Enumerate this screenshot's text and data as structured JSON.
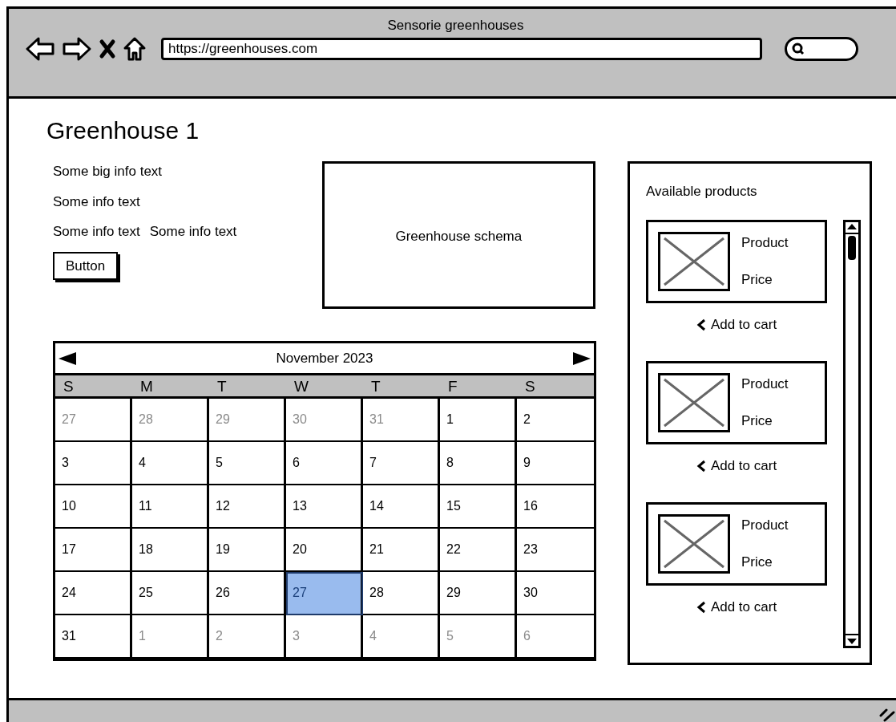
{
  "window": {
    "title": "Sensorie greenhouses"
  },
  "toolbar": {
    "url": "https://greenhouses.com"
  },
  "page": {
    "heading": "Greenhouse 1",
    "info_lines": [
      [
        "Some big info text"
      ],
      [
        "Some info text"
      ],
      [
        "Some info text",
        "Some info text"
      ]
    ],
    "button": "Button",
    "schema": {
      "label": "Greenhouse schema"
    }
  },
  "calendar": {
    "month": "November 2023",
    "weekdays": [
      "S",
      "M",
      "T",
      "W",
      "T",
      "F",
      "S"
    ],
    "weeks": [
      [
        {
          "day": "27",
          "outside": true,
          "selected": false
        },
        {
          "day": "28",
          "outside": true,
          "selected": false
        },
        {
          "day": "29",
          "outside": true,
          "selected": false
        },
        {
          "day": "30",
          "outside": true,
          "selected": false
        },
        {
          "day": "31",
          "outside": true,
          "selected": false
        },
        {
          "day": "1",
          "outside": false,
          "selected": false
        },
        {
          "day": "2",
          "outside": false,
          "selected": false
        }
      ],
      [
        {
          "day": "3",
          "outside": false,
          "selected": false
        },
        {
          "day": "4",
          "outside": false,
          "selected": false
        },
        {
          "day": "5",
          "outside": false,
          "selected": false
        },
        {
          "day": "6",
          "outside": false,
          "selected": false
        },
        {
          "day": "7",
          "outside": false,
          "selected": false
        },
        {
          "day": "8",
          "outside": false,
          "selected": false
        },
        {
          "day": "9",
          "outside": false,
          "selected": false
        }
      ],
      [
        {
          "day": "10",
          "outside": false,
          "selected": false
        },
        {
          "day": "11",
          "outside": false,
          "selected": false
        },
        {
          "day": "12",
          "outside": false,
          "selected": false
        },
        {
          "day": "13",
          "outside": false,
          "selected": false
        },
        {
          "day": "14",
          "outside": false,
          "selected": false
        },
        {
          "day": "15",
          "outside": false,
          "selected": false
        },
        {
          "day": "16",
          "outside": false,
          "selected": false
        }
      ],
      [
        {
          "day": "17",
          "outside": false,
          "selected": false
        },
        {
          "day": "18",
          "outside": false,
          "selected": false
        },
        {
          "day": "19",
          "outside": false,
          "selected": false
        },
        {
          "day": "20",
          "outside": false,
          "selected": false
        },
        {
          "day": "21",
          "outside": false,
          "selected": false
        },
        {
          "day": "22",
          "outside": false,
          "selected": false
        },
        {
          "day": "23",
          "outside": false,
          "selected": false
        }
      ],
      [
        {
          "day": "24",
          "outside": false,
          "selected": false
        },
        {
          "day": "25",
          "outside": false,
          "selected": false
        },
        {
          "day": "26",
          "outside": false,
          "selected": false
        },
        {
          "day": "27",
          "outside": false,
          "selected": true
        },
        {
          "day": "28",
          "outside": false,
          "selected": false
        },
        {
          "day": "29",
          "outside": false,
          "selected": false
        },
        {
          "day": "30",
          "outside": false,
          "selected": false
        }
      ],
      [
        {
          "day": "31",
          "outside": false,
          "selected": false
        },
        {
          "day": "1",
          "outside": true,
          "selected": false
        },
        {
          "day": "2",
          "outside": true,
          "selected": false
        },
        {
          "day": "3",
          "outside": true,
          "selected": false
        },
        {
          "day": "4",
          "outside": true,
          "selected": false
        },
        {
          "day": "5",
          "outside": true,
          "selected": false
        },
        {
          "day": "6",
          "outside": true,
          "selected": false
        }
      ]
    ]
  },
  "products": {
    "title": "Available products",
    "items": [
      {
        "name": "Product",
        "price": "Price",
        "action": "Add to cart"
      },
      {
        "name": "Product",
        "price": "Price",
        "action": "Add to cart"
      },
      {
        "name": "Product",
        "price": "Price",
        "action": "Add to cart"
      }
    ]
  }
}
